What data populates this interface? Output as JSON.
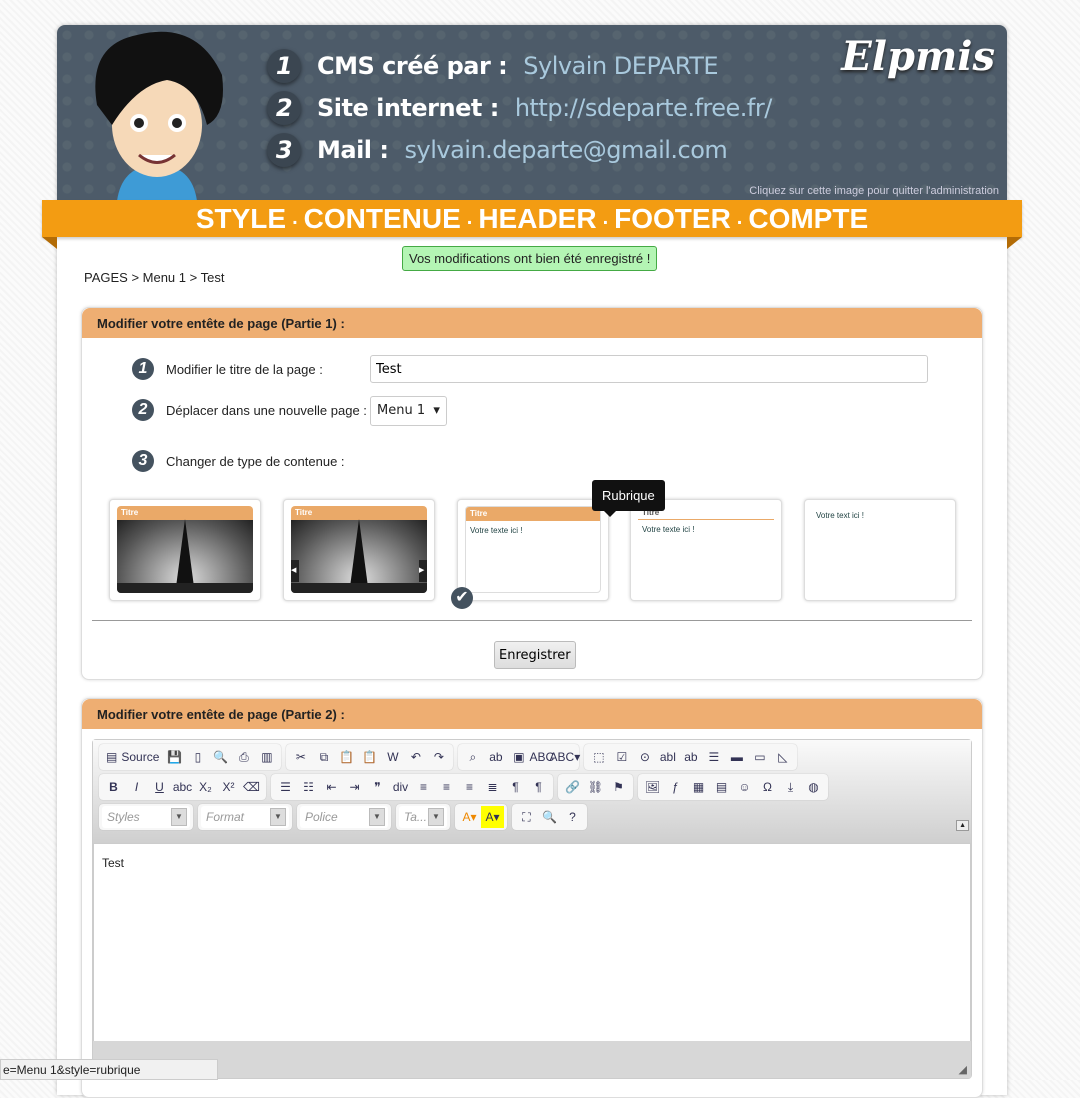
{
  "header": {
    "lines": [
      {
        "num": "1",
        "label": "CMS créé par :",
        "value": "Sylvain DEPARTE"
      },
      {
        "num": "2",
        "label": "Site internet :",
        "value": "http://sdeparte.free.fr/"
      },
      {
        "num": "3",
        "label": "Mail :",
        "value": "sylvain.departe@gmail.com"
      }
    ],
    "logo": "Elpmis",
    "quit": "Cliquez sur cette image pour quitter l'administration"
  },
  "nav": [
    "STYLE",
    "CONTENUE",
    "HEADER",
    "FOOTER",
    "COMPTE"
  ],
  "notice": "Vos modifications ont bien été enregistré !",
  "breadcrumb": "PAGES > Menu 1 > Test",
  "panel1": {
    "title": "Modifier votre entête de page (Partie 1) :",
    "rows": [
      {
        "num": "1",
        "label": "Modifier le titre de la page :"
      },
      {
        "num": "2",
        "label": "Déplacer dans une nouvelle page :"
      },
      {
        "num": "3",
        "label": "Changer de type de contenue :"
      }
    ],
    "title_value": "Test",
    "page_select": "Menu 1",
    "thumbs": [
      {
        "title": "Titre",
        "text": ""
      },
      {
        "title": "Titre",
        "text": ""
      },
      {
        "title": "Titre",
        "text": "Votre texte ici !"
      },
      {
        "title": "Titre",
        "text": "Votre texte ici !"
      },
      {
        "title": "",
        "text": "Votre text ici !"
      }
    ],
    "tooltip": "Rubrique",
    "selected": "Rubrique",
    "save": "Enregistrer"
  },
  "panel2": {
    "title": "Modifier votre entête de page (Partie 2) :",
    "toolbar": {
      "source": "Source",
      "combos": [
        "Styles",
        "Format",
        "Police",
        "Ta..."
      ],
      "rows": [
        [
          [
            "doc-icon",
            "save-icon",
            "new-page-icon",
            "preview-icon",
            "print-icon",
            "templates-icon"
          ],
          [
            "cut-icon",
            "copy-icon",
            "paste-icon",
            "paste-text-icon",
            "paste-word-icon",
            "undo-icon",
            "redo-icon"
          ],
          [
            "find-icon",
            "replace-icon",
            "select-all-icon",
            "spellcheck-icon",
            "spellcheck-auto-icon"
          ],
          [
            "form-icon",
            "checkbox-icon",
            "radio-icon",
            "textfield-icon",
            "textarea-icon",
            "select-icon",
            "button-icon",
            "image-button-icon",
            "hidden-field-icon"
          ]
        ],
        [
          [
            "bold-icon",
            "italic-icon",
            "underline-icon",
            "strike-icon",
            "subscript-icon",
            "superscript-icon",
            "remove-format-icon"
          ],
          [
            "numbered-list-icon",
            "bulleted-list-icon",
            "outdent-icon",
            "indent-icon",
            "blockquote-icon",
            "div-icon",
            "align-left-icon",
            "align-center-icon",
            "align-right-icon",
            "justify-icon",
            "ltr-icon",
            "rtl-icon"
          ],
          [
            "link-icon",
            "unlink-icon",
            "anchor-icon"
          ],
          [
            "image-icon",
            "flash-icon",
            "table-icon",
            "hr-icon",
            "smiley-icon",
            "special-char-icon",
            "page-break-icon",
            "iframe-icon"
          ]
        ],
        [
          [
            "text-color-icon",
            "bg-color-icon"
          ],
          [
            "maximize-icon",
            "show-blocks-icon",
            "about-icon"
          ]
        ]
      ]
    },
    "content": "Test"
  },
  "status_url": "e=Menu 1&style=rubrique",
  "colors": {
    "orange": "#f39c12",
    "panel_header": "#eeae72",
    "header_bg": "#4d5b69"
  }
}
